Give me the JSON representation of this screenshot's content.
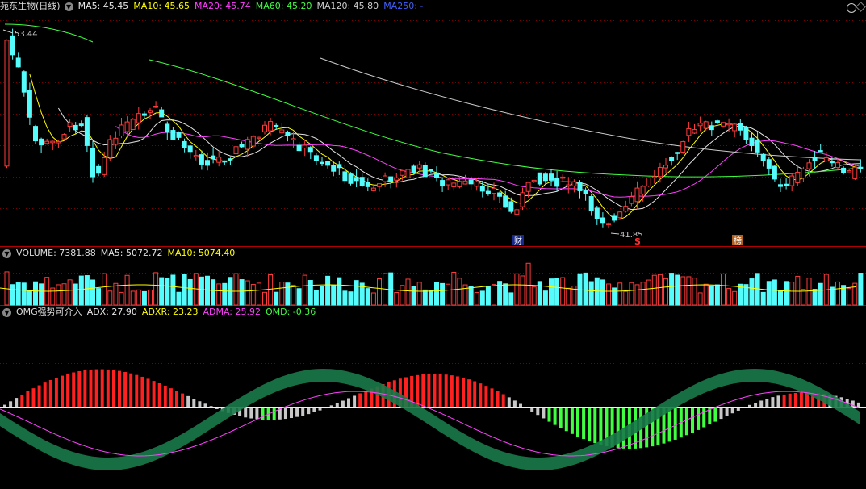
{
  "main_legend": {
    "title": "苑东生物(日线)",
    "ma5": "MA5: 45.45",
    "ma10": "MA10: 45.65",
    "ma20": "MA20: 45.74",
    "ma60": "MA60: 45.20",
    "ma120": "MA120: 45.80",
    "ma250": "MA250: -"
  },
  "volume_legend": {
    "title": "VOLUME: 7381.88",
    "ma5": "MA5: 5072.72",
    "ma10": "MA10: 5074.40"
  },
  "omg_legend": {
    "title": "OMG强势可介入",
    "adx": "ADX: 27.90",
    "adxr": "ADXR: 23.23",
    "adma": "ADMA: 25.92",
    "omd": "OMD: -0.36"
  },
  "annotations": {
    "high": "53.44",
    "low": "41.85",
    "tag_cai": "财",
    "tag_s": "S",
    "tag_bang": "榜"
  },
  "colors": {
    "up": "#ff3b3b",
    "down": "#54fcfc",
    "ma5": "#e6e6e6",
    "ma10": "#ffff00",
    "ma20": "#ff40ff",
    "ma60": "#40ff40",
    "ma120": "#cccccc",
    "ma250": "#4060ff",
    "grid": "#7a0000",
    "adx_hist_up": "#ff2020",
    "adx_hist_down": "#40ff40",
    "adx_hist_neutral": "#c8c8c8"
  }
}
